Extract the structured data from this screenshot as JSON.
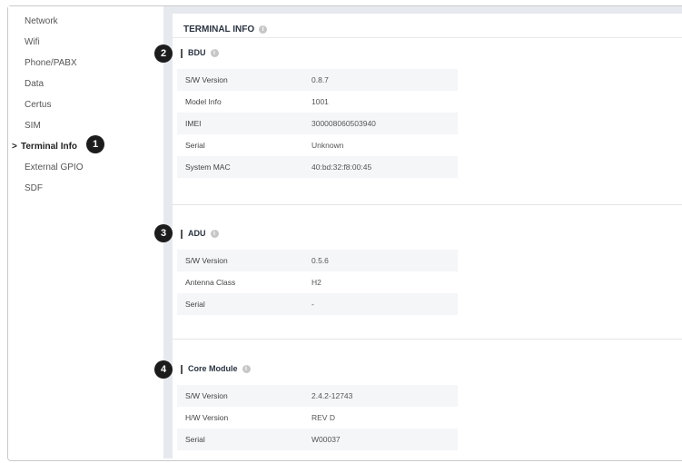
{
  "sidebar": {
    "items": [
      {
        "label": "Network"
      },
      {
        "label": "Wifi"
      },
      {
        "label": "Phone/PABX"
      },
      {
        "label": "Data"
      },
      {
        "label": "Certus"
      },
      {
        "label": "SIM"
      },
      {
        "label": "Terminal Info",
        "active": true
      },
      {
        "label": "External GPIO"
      },
      {
        "label": "SDF"
      }
    ],
    "active_chevron": ">"
  },
  "panel": {
    "title": "TERMINAL INFO"
  },
  "info_glyph": "i",
  "sections": {
    "bdu": {
      "title": "BDU",
      "rows": [
        {
          "key": "S/W Version",
          "value": "0.8.7"
        },
        {
          "key": "Model Info",
          "value": "1001"
        },
        {
          "key": "IMEI",
          "value": "300008060503940"
        },
        {
          "key": "Serial",
          "value": "Unknown"
        },
        {
          "key": "System MAC",
          "value": "40:bd:32:f8:00:45"
        }
      ]
    },
    "adu": {
      "title": "ADU",
      "rows": [
        {
          "key": "S/W Version",
          "value": "0.5.6"
        },
        {
          "key": "Antenna Class",
          "value": "H2"
        },
        {
          "key": "Serial",
          "value": "-"
        }
      ]
    },
    "core": {
      "title": "Core Module",
      "rows": [
        {
          "key": "S/W Version",
          "value": "2.4.2-12743"
        },
        {
          "key": "H/W Version",
          "value": "REV D"
        },
        {
          "key": "Serial",
          "value": "W00037"
        }
      ]
    }
  },
  "badges": [
    "1",
    "2",
    "3",
    "4"
  ],
  "colors": {
    "content_bg": "#e6e9ee",
    "badge": "#1c1c1c",
    "row_stripe": "#f5f6f8"
  }
}
